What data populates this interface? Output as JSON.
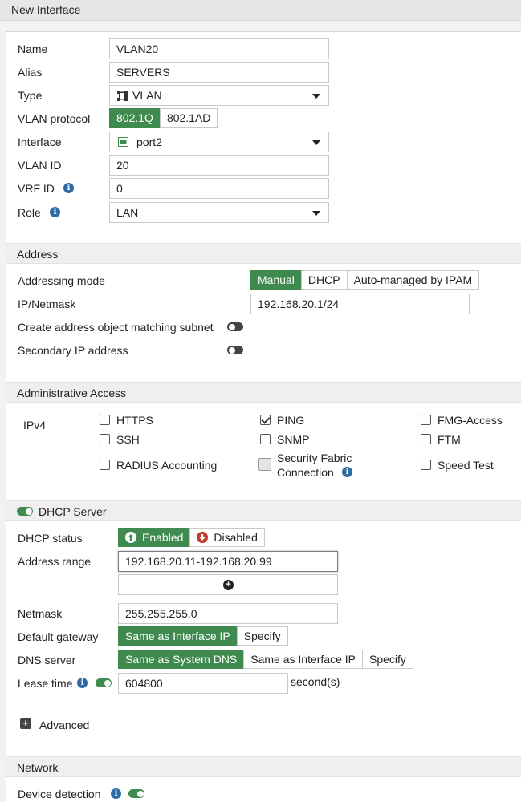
{
  "title": "New Interface",
  "general": {
    "name_label": "Name",
    "name_value": "VLAN20",
    "alias_label": "Alias",
    "alias_value": "SERVERS",
    "type_label": "Type",
    "type_value": "VLAN",
    "vlan_protocol_label": "VLAN protocol",
    "vlan_protocol_options": [
      "802.1Q",
      "802.1AD"
    ],
    "vlan_protocol_selected": "802.1Q",
    "interface_label": "Interface",
    "interface_value": "port2",
    "vlan_id_label": "VLAN ID",
    "vlan_id_value": "20",
    "vrf_id_label": "VRF ID",
    "vrf_id_value": "0",
    "role_label": "Role",
    "role_value": "LAN"
  },
  "address": {
    "section_title": "Address",
    "mode_label": "Addressing mode",
    "mode_options": [
      "Manual",
      "DHCP",
      "Auto-managed by IPAM"
    ],
    "mode_selected": "Manual",
    "ip_label": "IP/Netmask",
    "ip_value": "192.168.20.1/24",
    "create_object_label": "Create address object matching subnet",
    "create_object_enabled": false,
    "secondary_label": "Secondary IP address",
    "secondary_enabled": false
  },
  "admin_access": {
    "section_title": "Administrative Access",
    "ipv4_label": "IPv4",
    "items": [
      {
        "label": "HTTPS",
        "checked": false
      },
      {
        "label": "PING",
        "checked": true
      },
      {
        "label": "FMG-Access",
        "checked": false
      },
      {
        "label": "SSH",
        "checked": false
      },
      {
        "label": "SNMP",
        "checked": false
      },
      {
        "label": "FTM",
        "checked": false
      },
      {
        "label": "RADIUS Accounting",
        "checked": false
      },
      {
        "label": "Security Fabric",
        "label2": "Connection",
        "checked": false
      },
      {
        "label": "Speed Test",
        "checked": false
      }
    ]
  },
  "dhcp": {
    "section_title": "DHCP Server",
    "enabled": true,
    "status_label": "DHCP status",
    "status_options": [
      "Enabled",
      "Disabled"
    ],
    "status_selected": "Enabled",
    "range_label": "Address range",
    "range_value": "192.168.20.11-192.168.20.99",
    "netmask_label": "Netmask",
    "netmask_value": "255.255.255.0",
    "gateway_label": "Default gateway",
    "gateway_options": [
      "Same as Interface IP",
      "Specify"
    ],
    "gateway_selected": "Same as Interface IP",
    "dns_label": "DNS server",
    "dns_options": [
      "Same as System DNS",
      "Same as Interface IP",
      "Specify"
    ],
    "dns_selected": "Same as System DNS",
    "lease_label": "Lease time",
    "lease_value": "604800",
    "lease_unit": "second(s)",
    "lease_enabled": true,
    "advanced_label": "Advanced"
  },
  "network": {
    "section_title": "Network",
    "device_detection_label": "Device detection",
    "device_detection_enabled": true
  },
  "colors": {
    "accent_green": "#3f8a4f",
    "info_blue": "#2d6aa6",
    "disabled_red": "#c0392b"
  },
  "icons": {
    "type": "vlan-icon",
    "interface": "port-icon",
    "info": "info-icon",
    "add": "plus-circle-icon",
    "advanced": "plus-box-icon"
  }
}
